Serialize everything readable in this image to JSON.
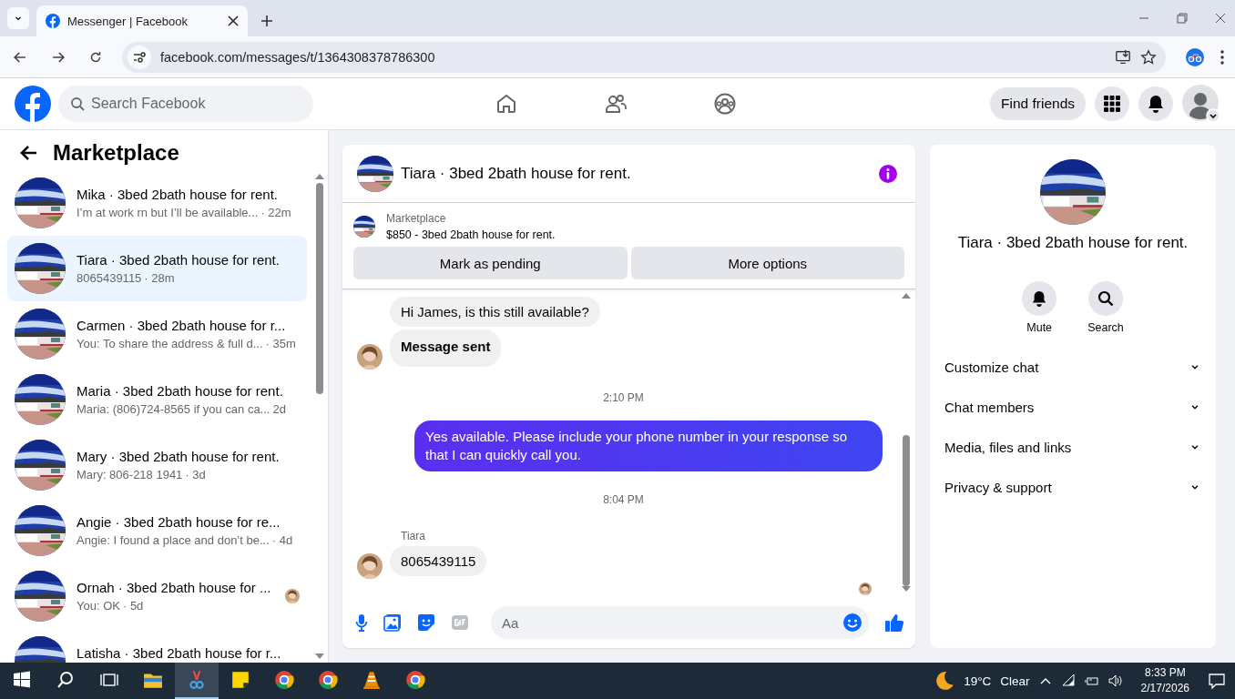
{
  "browser": {
    "tab_title": "Messenger | Facebook",
    "url": "facebook.com/messages/t/1364308378786300"
  },
  "header": {
    "search_placeholder": "Search Facebook",
    "find_friends": "Find friends"
  },
  "sidebar": {
    "title": "Marketplace",
    "conversations": [
      {
        "title": "Mika · 3bed 2bath house for rent.",
        "preview": "I’m at work rn but I’ll be available...",
        "time": "· 22m",
        "selected": false,
        "read_receipt": false
      },
      {
        "title": "Tiara · 3bed 2bath house for rent.",
        "preview": "8065439115",
        "time": "· 28m",
        "selected": true,
        "read_receipt": false
      },
      {
        "title": "Carmen · 3bed 2bath house for r...",
        "preview": "You: To share the address & full d...",
        "time": "· 35m",
        "selected": false,
        "read_receipt": false
      },
      {
        "title": "Maria · 3bed 2bath house for rent.",
        "preview": "Maria: (806)724-8565 if you can ca...",
        "time": "2d",
        "selected": false,
        "read_receipt": false
      },
      {
        "title": "Mary · 3bed 2bath house for rent.",
        "preview": "Mary: 806-218 1941",
        "time": "· 3d",
        "selected": false,
        "read_receipt": false
      },
      {
        "title": "Angie · 3bed 2bath house for re...",
        "preview": "Angie: I found a place and don’t be...",
        "time": "· 4d",
        "selected": false,
        "read_receipt": false
      },
      {
        "title": "Ornah · 3bed 2bath house for ...",
        "preview": "You: OK",
        "time": "· 5d",
        "selected": false,
        "read_receipt": true
      },
      {
        "title": "Latisha · 3bed 2bath house for r...",
        "selected": false,
        "read_receipt": false
      }
    ]
  },
  "chat": {
    "title": "Tiara · 3bed 2bath house for rent.",
    "listing": {
      "label": "Marketplace",
      "title": "$850 - 3bed 2bath house for rent.",
      "buttons": [
        "Mark as pending",
        "More options"
      ]
    },
    "messages": [
      {
        "kind": "incoming",
        "text": "Hi James, is this still available?",
        "avatar": false,
        "bold": false
      },
      {
        "kind": "incoming",
        "text": "Message sent",
        "avatar": true,
        "bold": true
      },
      {
        "kind": "time",
        "text": "2:10 PM"
      },
      {
        "kind": "outgoing",
        "text": "Yes available. Please include your phone number in your response so that I can quickly call you."
      },
      {
        "kind": "time",
        "text": "8:04 PM"
      },
      {
        "kind": "sender",
        "text": "Tiara"
      },
      {
        "kind": "incoming",
        "text": "8065439115",
        "avatar": true,
        "bold": false
      },
      {
        "kind": "seen"
      }
    ],
    "composer_placeholder": "Aa"
  },
  "details": {
    "name": "Tiara · 3bed 2bath house for rent.",
    "actions": [
      {
        "kind": "mute",
        "label": "Mute"
      },
      {
        "kind": "search",
        "label": "Search"
      }
    ],
    "sections": [
      {
        "label": "Customize chat",
        "expanded": false
      },
      {
        "label": "Chat members",
        "expanded": false
      },
      {
        "label": "Media, files and links",
        "expanded": false
      },
      {
        "label": "Privacy & support",
        "expanded": false
      }
    ]
  },
  "taskbar": {
    "apps": [
      {
        "kind": "folder",
        "selected": false
      },
      {
        "kind": "snip",
        "selected": true
      },
      {
        "kind": "notes",
        "selected": false
      },
      {
        "kind": "chrome",
        "selected": false
      },
      {
        "kind": "chrome",
        "selected": false
      },
      {
        "kind": "vlc",
        "selected": false
      },
      {
        "kind": "chrome",
        "selected": false
      }
    ],
    "temperature": "19°C",
    "weather": "Clear",
    "time": "8:33 PM",
    "date": "2/17/2026"
  }
}
